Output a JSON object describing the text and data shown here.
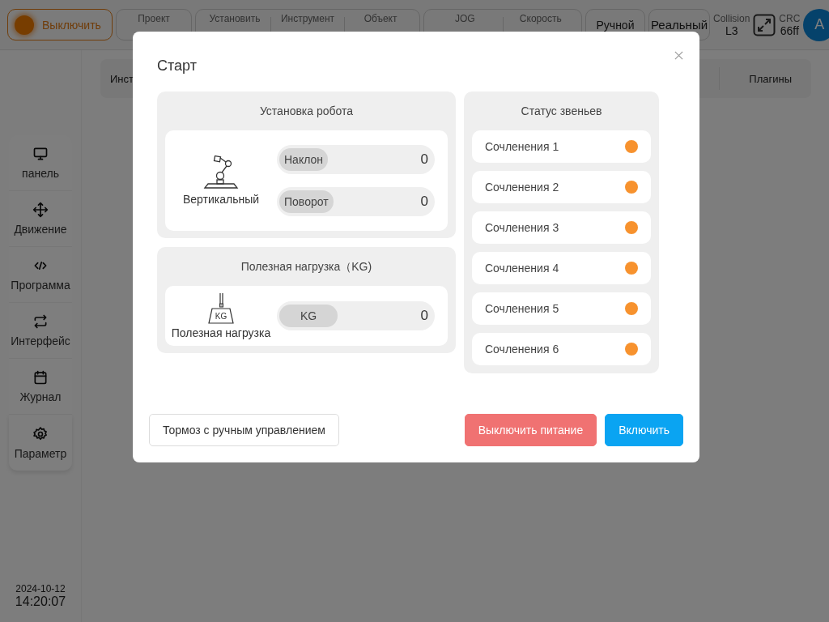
{
  "header": {
    "power_button": "Выключить",
    "groups": [
      [
        {
          "label": "Проект"
        }
      ],
      [
        {
          "label": "Установить"
        },
        {
          "label": "Инструмент"
        },
        {
          "label": "Объект"
        }
      ],
      [
        {
          "label": "JOG"
        },
        {
          "label": "Скорость"
        }
      ]
    ],
    "mode_buttons": [
      "Ручной",
      "Реальный"
    ],
    "collision": {
      "label": "Collision",
      "value": "L3"
    },
    "crc": {
      "label": "CRC",
      "value": "66ff"
    },
    "avatar": "A"
  },
  "tabs": [
    "Инст",
    "Плагины"
  ],
  "sidebar": [
    {
      "kind": "monitor",
      "label": "панель"
    },
    {
      "kind": "move",
      "label": "Движение"
    },
    {
      "kind": "code",
      "label": "Программа"
    },
    {
      "kind": "swap",
      "label": "Интерфейс"
    },
    {
      "kind": "calendar",
      "label": "Журнал"
    },
    {
      "kind": "gear",
      "label": "Параметр"
    }
  ],
  "datetime": {
    "date": "2024-10-12",
    "time": "14:20:07"
  },
  "dialog": {
    "title": "Старт",
    "setup": {
      "title": "Установка робота",
      "mount": "Вертикальный",
      "fields": [
        {
          "label": "Наклон",
          "value": "0"
        },
        {
          "label": "Поворот",
          "value": "0"
        }
      ]
    },
    "payload": {
      "title": "Полезная нагрузка（KG)",
      "icon_text": "KG",
      "caption": "Полезная нагрузка",
      "field": {
        "label": "KG",
        "value": "0"
      }
    },
    "joints": {
      "title": "Статус звеньев",
      "items": [
        {
          "name": "Сочленения 1",
          "color": "#f7922e"
        },
        {
          "name": "Сочленения 2",
          "color": "#f7922e"
        },
        {
          "name": "Сочленения 3",
          "color": "#f7922e"
        },
        {
          "name": "Сочленения 4",
          "color": "#f7922e"
        },
        {
          "name": "Сочленения 5",
          "color": "#f7922e"
        },
        {
          "name": "Сочленения 6",
          "color": "#f7922e"
        }
      ]
    },
    "buttons": {
      "brake": "Тормоз с ручным управлением",
      "power_off": "Выключить питание",
      "enable": "Включить"
    }
  }
}
